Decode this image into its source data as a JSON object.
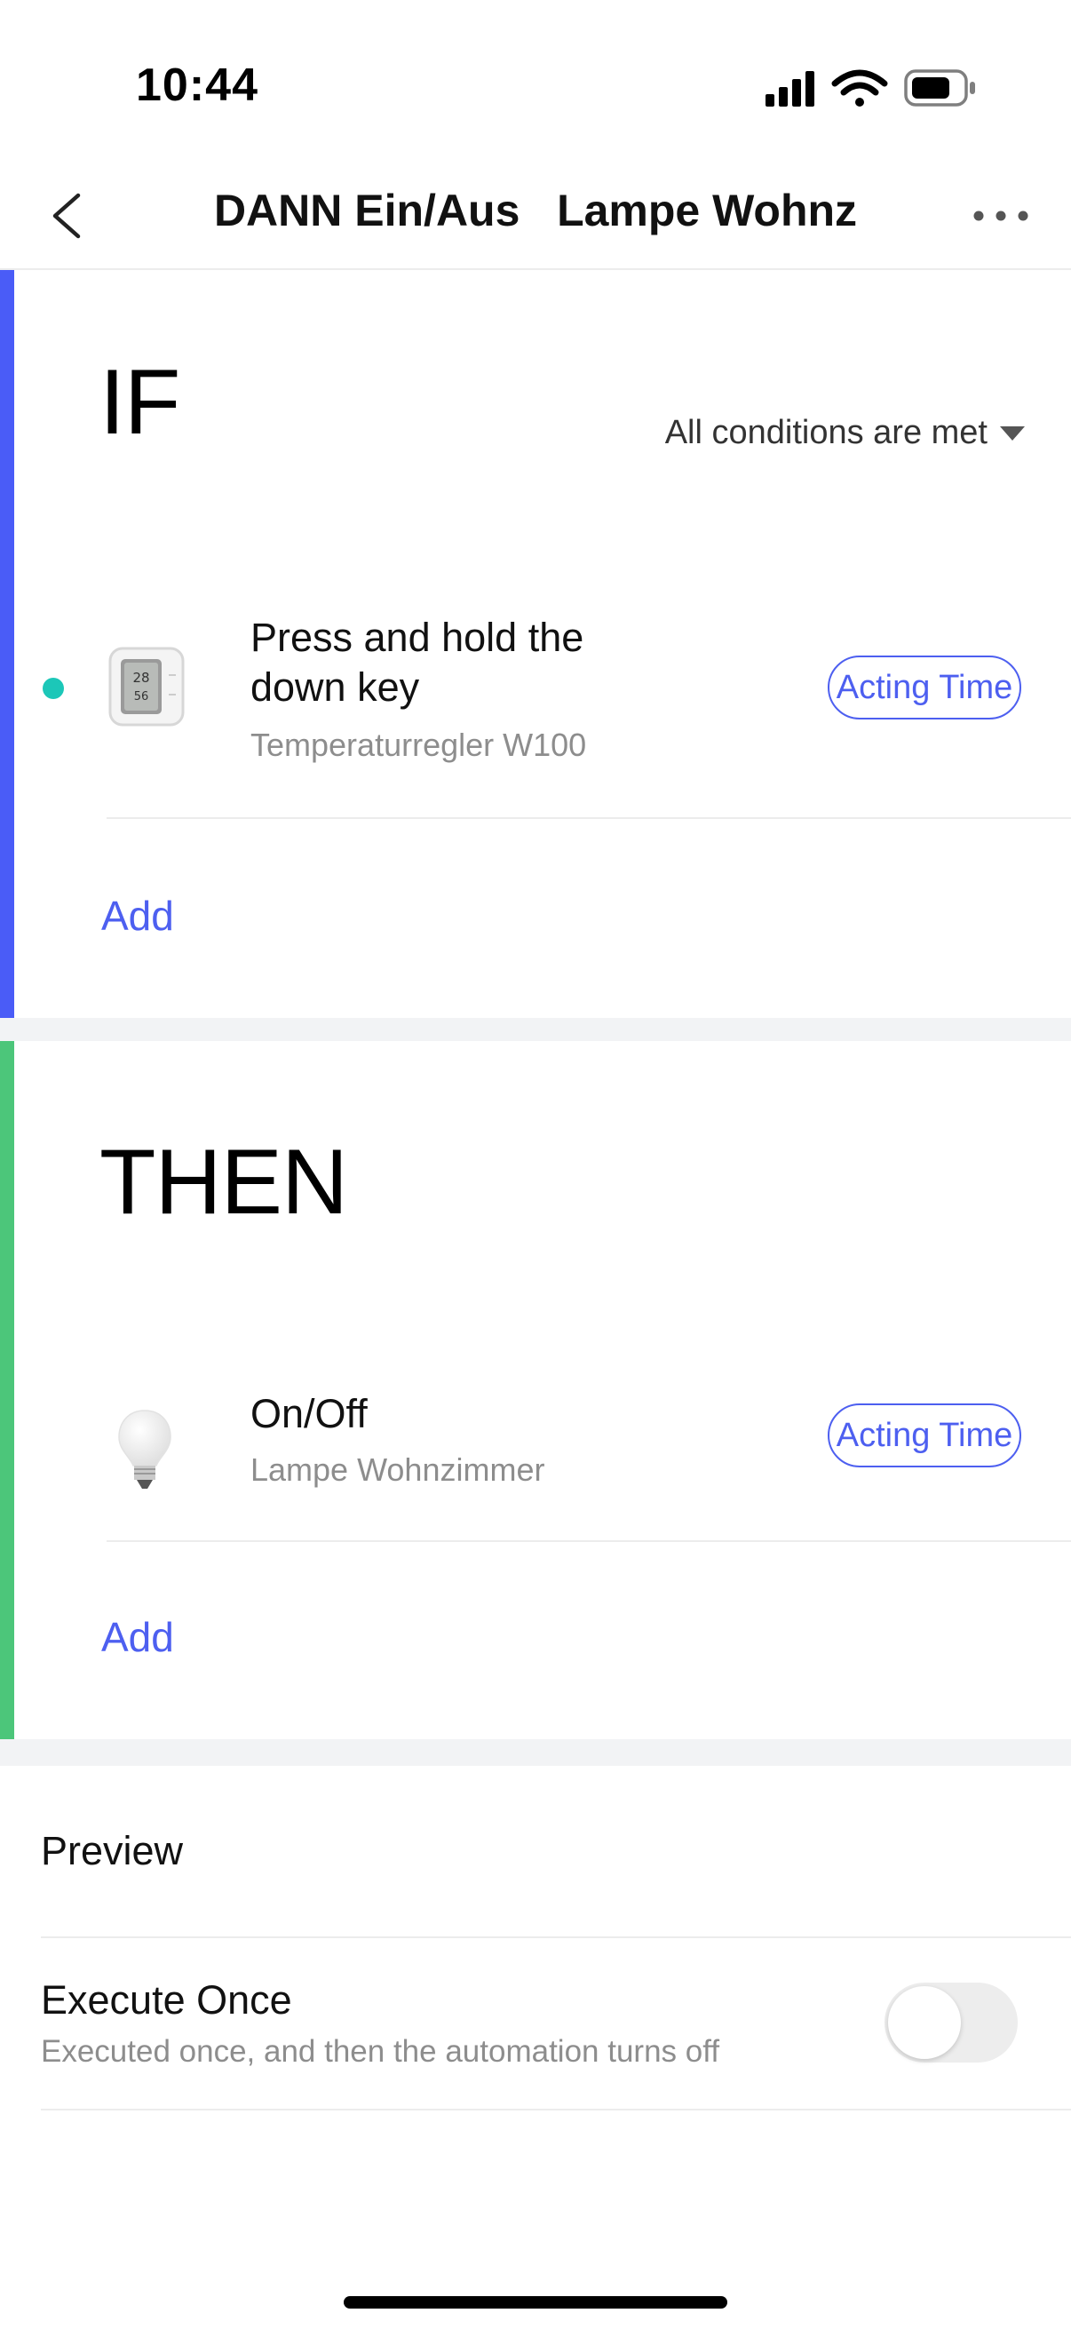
{
  "status_bar": {
    "time": "10:44"
  },
  "nav": {
    "title": "DANN Ein/Aus   Lampe Wohnz"
  },
  "colors": {
    "accent": "#4d5ff0",
    "if_bar": "#4a5cf7",
    "then_bar": "#4cc67a",
    "teal_dot": "#1cc7b8"
  },
  "if_section": {
    "label": "IF",
    "condition_mode": "All conditions are met",
    "conditions": [
      {
        "title_line1": "Press and hold the",
        "title_line2": "down key",
        "device": "Temperaturregler W100",
        "action_label": "Acting Time",
        "icon": "thermostat-icon"
      }
    ],
    "add_label": "Add"
  },
  "then_section": {
    "label": "THEN",
    "actions": [
      {
        "title": "On/Off",
        "device": "Lampe Wohnzimmer",
        "action_label": "Acting Time",
        "icon": "bulb-icon"
      }
    ],
    "add_label": "Add"
  },
  "options": {
    "preview_label": "Preview",
    "execute_once": {
      "title": "Execute Once",
      "subtitle": "Executed once, and then the automation turns off",
      "enabled": false
    }
  }
}
